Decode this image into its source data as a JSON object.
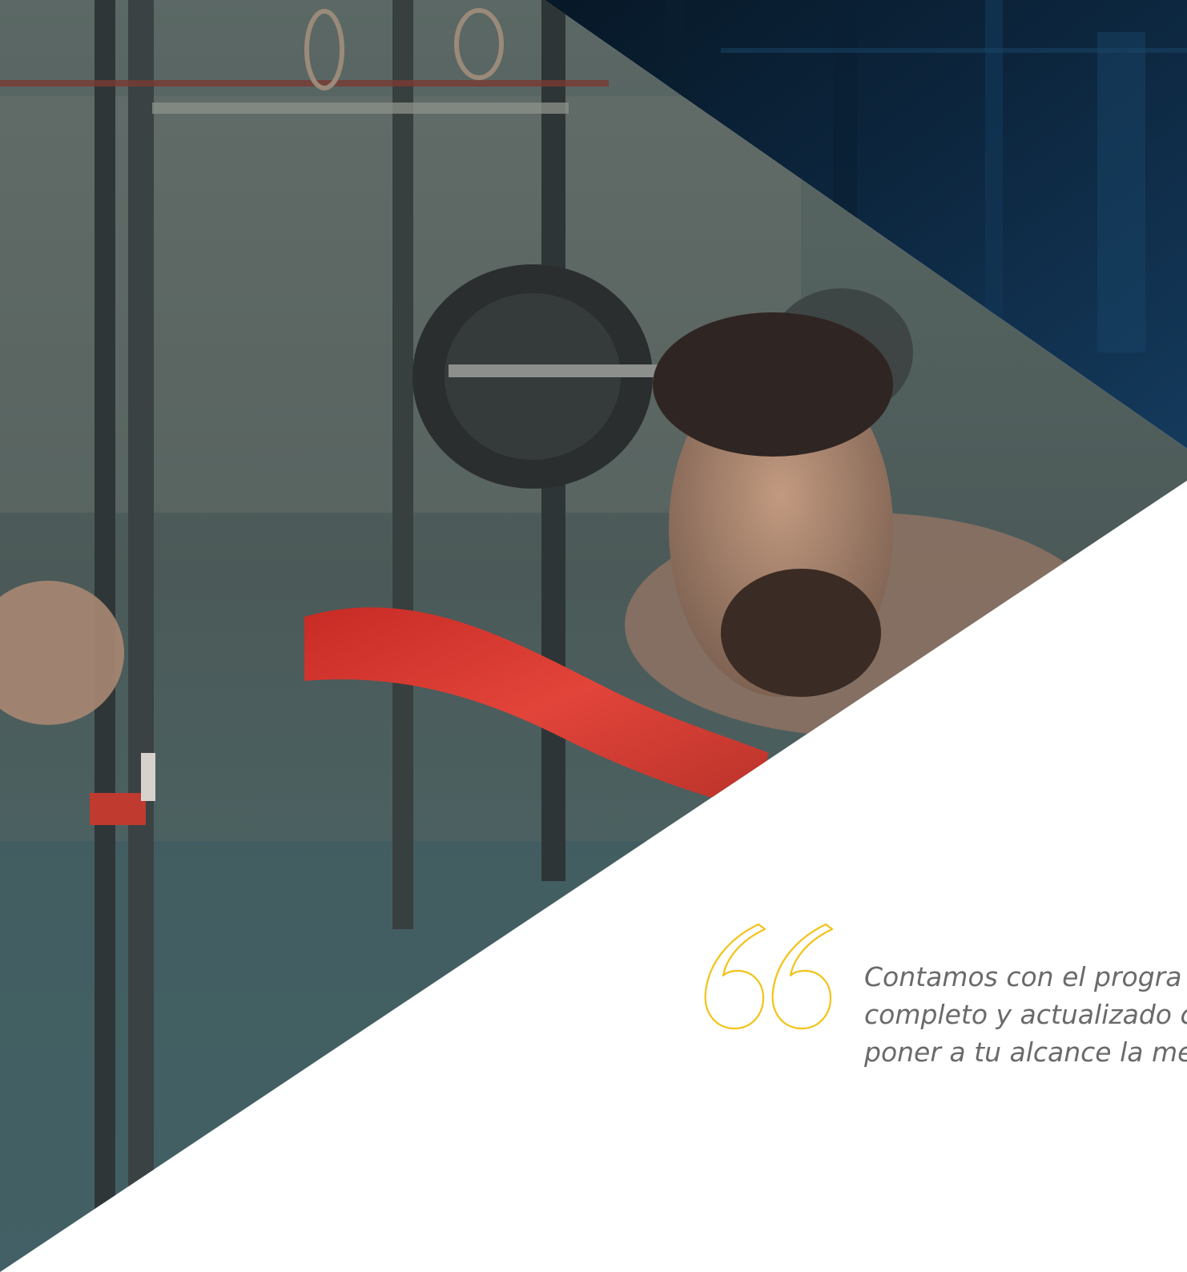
{
  "quote": {
    "icon": "quote-open-icon",
    "accent_color": "#f2c319",
    "lines": [
      "Contamos con el progra",
      "completo y actualizado c",
      "poner a tu alcance la me"
    ]
  },
  "colors": {
    "dark_panel": "#0f2d48",
    "photo_tint": "#4c6466",
    "rope_red": "#d8322a",
    "background": "#ffffff"
  }
}
